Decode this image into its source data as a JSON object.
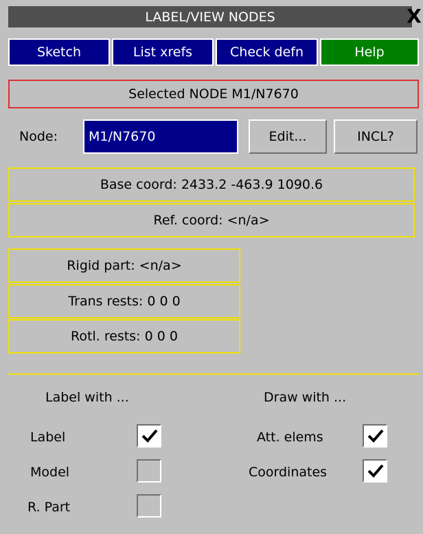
{
  "window": {
    "title": "LABEL/VIEW NODES",
    "close_glyph": "X"
  },
  "tabs": [
    {
      "label": "Sketch",
      "color": "#00008b"
    },
    {
      "label": "List xrefs",
      "color": "#00008b"
    },
    {
      "label": "Check defn",
      "color": "#00008b"
    },
    {
      "label": "Help",
      "color": "#008000"
    }
  ],
  "selected_banner": "Selected NODE M1/N7670",
  "node_row": {
    "label": "Node:",
    "value": "M1/N7670",
    "edit_label": "Edit...",
    "incl_label": "INCL?"
  },
  "coords": {
    "base": "Base coord:  2433.2   -463.9   1090.6",
    "ref": "Ref. coord: <n/a>"
  },
  "part_info": {
    "rigid_part": "Rigid part: <n/a>",
    "trans_rests": "Trans rests:  0  0  0",
    "rotl_rests": "Rotl. rests:  0  0  0"
  },
  "label_with": {
    "heading": "Label with ...",
    "options": [
      {
        "label": "Label",
        "checked": true
      },
      {
        "label": "Model",
        "checked": false
      },
      {
        "label": "R. Part",
        "checked": false
      }
    ]
  },
  "draw_with": {
    "heading": "Draw with ...",
    "options": [
      {
        "label": "Att. elems",
        "checked": true
      },
      {
        "label": "Coordinates",
        "checked": true
      }
    ]
  },
  "colors": {
    "accent_blue": "#00008b",
    "help_green": "#008000",
    "highlight_yellow": "#f0e000",
    "selected_red": "#e03030",
    "panel_grey": "#c0c0c0"
  }
}
